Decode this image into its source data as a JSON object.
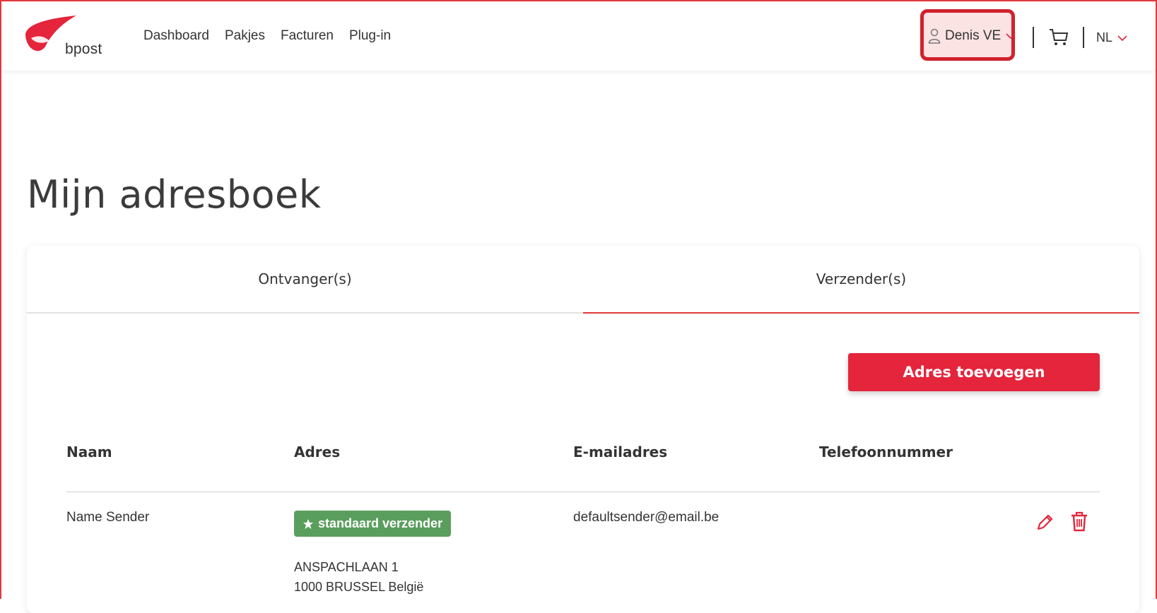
{
  "brand": {
    "name": "bpost",
    "accent": "#e4253c",
    "badge_color": "#5a9e5d"
  },
  "nav": {
    "items": [
      "Dashboard",
      "Pakjes",
      "Facturen",
      "Plug-in"
    ]
  },
  "user": {
    "name": "Denis VE"
  },
  "language": {
    "selected": "NL"
  },
  "page": {
    "title": "Mijn adresboek"
  },
  "tabs": [
    {
      "label": "Ontvanger(s)",
      "active": false
    },
    {
      "label": "Verzender(s)",
      "active": true
    }
  ],
  "actions": {
    "add_address": "Adres toevoegen"
  },
  "table": {
    "columns": [
      "Naam",
      "Adres",
      "E-mailadres",
      "Telefoonnummer"
    ],
    "rows": [
      {
        "name": "Name Sender",
        "badge": "standaard verzender",
        "address_line1": "ANSPACHLAAN 1",
        "address_line2": "1000 BRUSSEL België",
        "email": "defaultsender@email.be",
        "phone": ""
      }
    ]
  },
  "icons": [
    "bpost-logo",
    "user-icon",
    "chevron-down-icon",
    "cart-icon",
    "star-icon",
    "pencil-icon",
    "trash-icon"
  ]
}
